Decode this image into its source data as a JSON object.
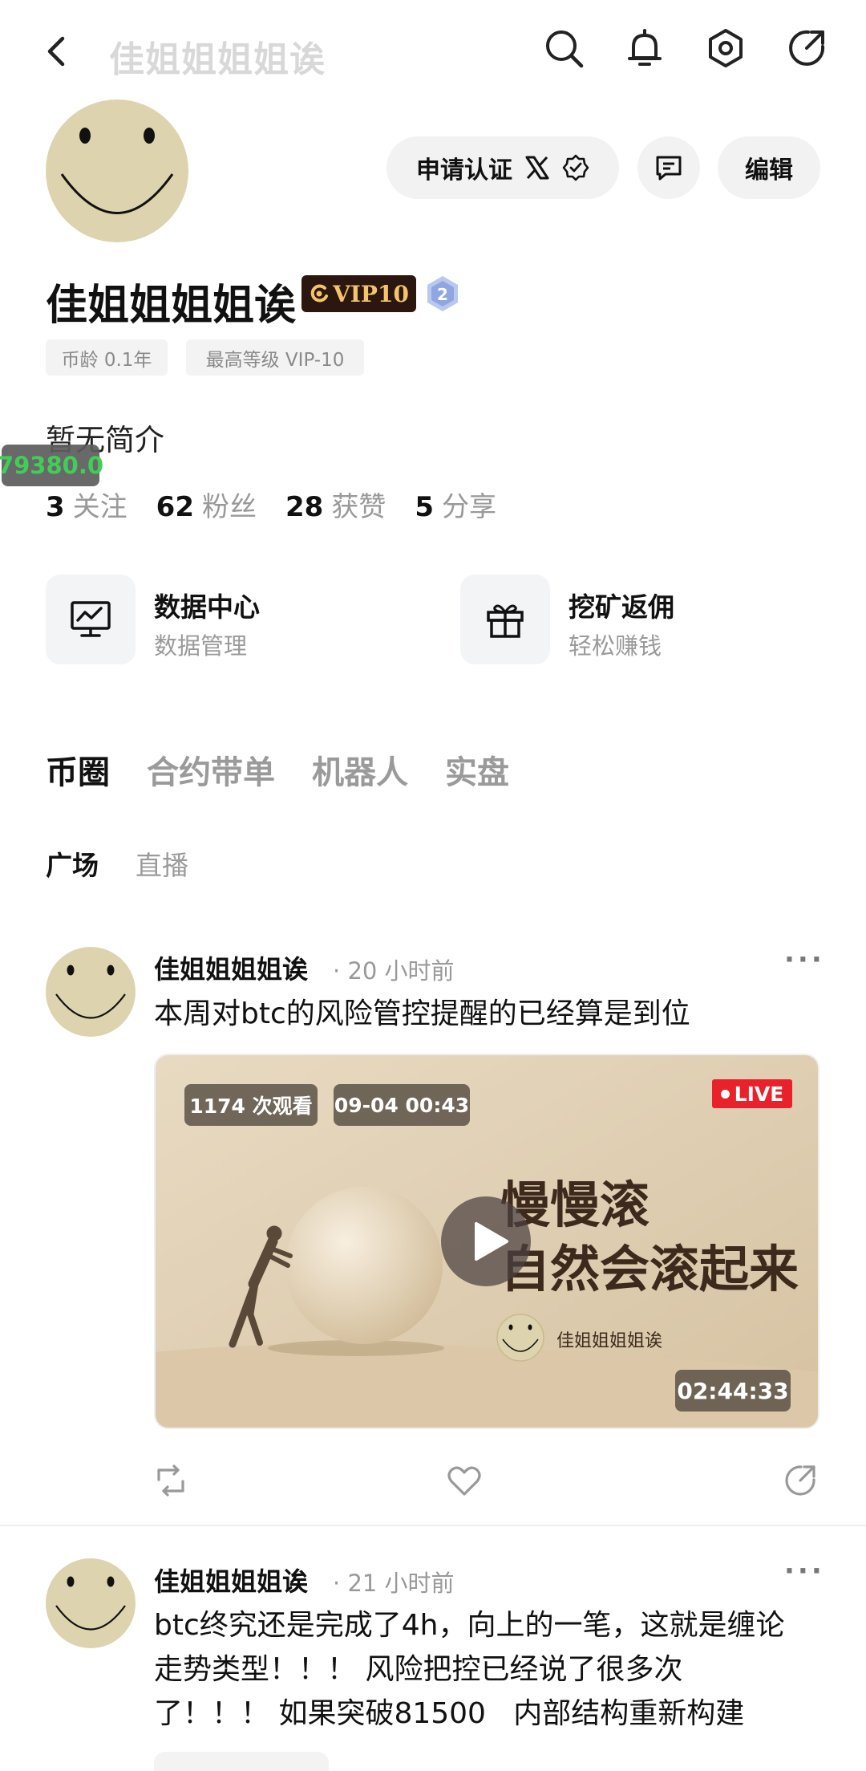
{
  "header": {
    "title": "佳姐姐姐姐诶",
    "icons": [
      "back-icon",
      "search-icon",
      "bell-icon",
      "settings-hex-icon",
      "share-icon"
    ]
  },
  "profile": {
    "apply_verify_label": "申请认证",
    "edit_label": "编辑",
    "name": "佳姐姐姐姐诶",
    "vip_label": "VIP10",
    "level_badge": "2",
    "tags": [
      "币龄 0.1年",
      "最高等级 VIP-10"
    ],
    "bio": "暂无简介",
    "floating_price": "79380.0",
    "stats": [
      {
        "num": "3",
        "label": "关注"
      },
      {
        "num": "62",
        "label": "粉丝"
      },
      {
        "num": "28",
        "label": "获赞"
      },
      {
        "num": "5",
        "label": "分享"
      }
    ]
  },
  "cards": [
    {
      "title": "数据中心",
      "subtitle": "数据管理",
      "icon": "chart-monitor-icon"
    },
    {
      "title": "挖矿返佣",
      "subtitle": "轻松赚钱",
      "icon": "gift-icon"
    }
  ],
  "tabs": [
    "币圈",
    "合约带单",
    "机器人",
    "实盘"
  ],
  "subtabs": [
    "广场",
    "直播"
  ],
  "posts": [
    {
      "author": "佳姐姐姐姐诶",
      "time": "20 小时前",
      "text": "本周对btc的风险管控提醒的已经算是到位",
      "video": {
        "views": "1174 次观看",
        "date": "09-04 00:43",
        "live_label": "LIVE",
        "headline_1": "慢慢滚",
        "headline_2": "自然会滚起来",
        "channel": "佳姐姐姐姐诶",
        "duration": "02:44:33"
      }
    },
    {
      "author": "佳姐姐姐姐诶",
      "time": "21 小时前",
      "text_lines": [
        "btc终究还是完成了4h，向上的一笔，这就是缠论",
        "走势类型！！！ 风险把控已经说了很多次",
        "了！！！ 如果突破81500   内部结构重新构建"
      ]
    }
  ],
  "colors": {
    "accent_text": "#111111",
    "muted": "#999999",
    "price_green": "#30c94a",
    "live_red": "#e8212b",
    "vip_gold": "#f4c46a"
  }
}
